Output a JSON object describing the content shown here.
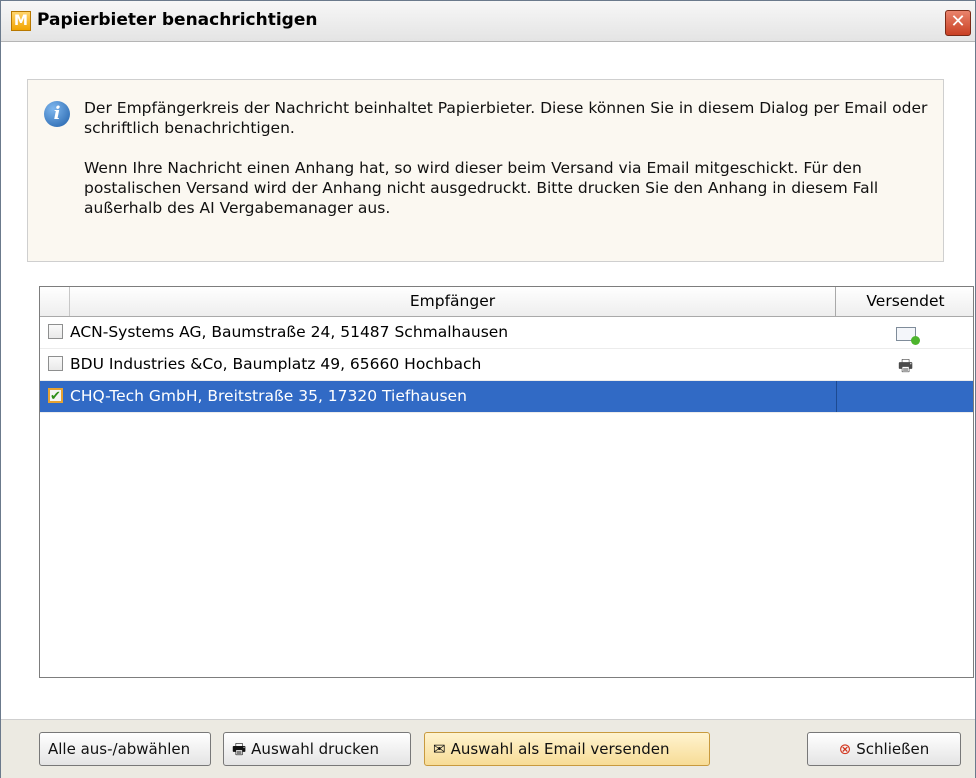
{
  "window": {
    "title": "Papierbieter benachrichtigen",
    "app_icon_letter": "M",
    "close_symbol": "✕"
  },
  "info": {
    "icon": "info-icon",
    "paragraph1": "Der Empfängerkreis der Nachricht beinhaltet Papierbieter. Diese können Sie in diesem Dialog per Email oder schriftlich benachrichtigen.",
    "paragraph2": "Wenn Ihre Nachricht einen Anhang hat, so wird dieser beim Versand via Email mitgeschickt. Für den postalischen Versand wird der Anhang nicht ausgedruckt. Bitte drucken Sie den Anhang in diesem Fall außerhalb des AI Vergabemanager aus."
  },
  "table": {
    "columns": [
      "Empfänger",
      "Versendet"
    ],
    "rows": [
      {
        "checked": false,
        "recipient": "ACN-Systems AG, Baumstraße 24, 51487 Schmalhausen",
        "sent": "email-sent-icon"
      },
      {
        "checked": false,
        "recipient": "BDU Industries &Co, Baumplatz 49, 65660 Hochbach",
        "sent": "printer-icon"
      },
      {
        "checked": true,
        "recipient": "CHQ-Tech GmbH, Breitstraße 35, 17320 Tiefhausen",
        "sent": ""
      }
    ]
  },
  "buttons": {
    "select_all": "Alle aus-/abwählen",
    "print": "Auswahl drucken",
    "email": "Auswahl als Email versenden",
    "close": "Schließen"
  },
  "colors": {
    "selection": "#316ac5",
    "info_background": "#fbf8f1",
    "button_bar": "#eceae2"
  }
}
